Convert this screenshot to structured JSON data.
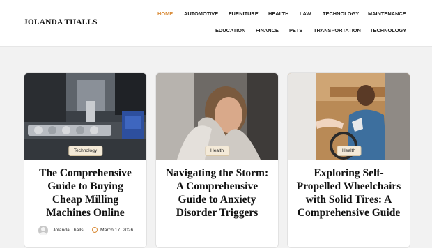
{
  "site": {
    "title": "JOLANDA THALLS"
  },
  "nav": {
    "row1": [
      "HOME",
      "AUTOMOTIVE",
      "FURNITURE",
      "HEALTH",
      "LAW",
      "TECHNOLOGY",
      "MAINTENANCE"
    ],
    "row2": [
      "EDUCATION",
      "FINANCE",
      "PETS",
      "TRANSPORTATION",
      "TECHNOLOGY"
    ],
    "active": "HOME"
  },
  "colors": {
    "accent": "#d98a35",
    "badge_bg": "#f4ead8"
  },
  "cards": [
    {
      "category": "Technology",
      "title": "The Comprehensive Guide to Buying Cheap Milling Machines Online",
      "author": "Jolanda Thalls",
      "date": "March 17, 2026",
      "image": "milling-machine-photo"
    },
    {
      "category": "Health",
      "title": "Navigating the Storm: A Comprehensive Guide to Anxiety Disorder Triggers",
      "author": "",
      "date": "",
      "image": "anxious-woman-photo"
    },
    {
      "category": "Health",
      "title": "Exploring Self-Propelled Wheelchairs with Solid Tires: A Comprehensive Guide",
      "author": "",
      "date": "",
      "image": "wheelchair-man-photo"
    }
  ]
}
